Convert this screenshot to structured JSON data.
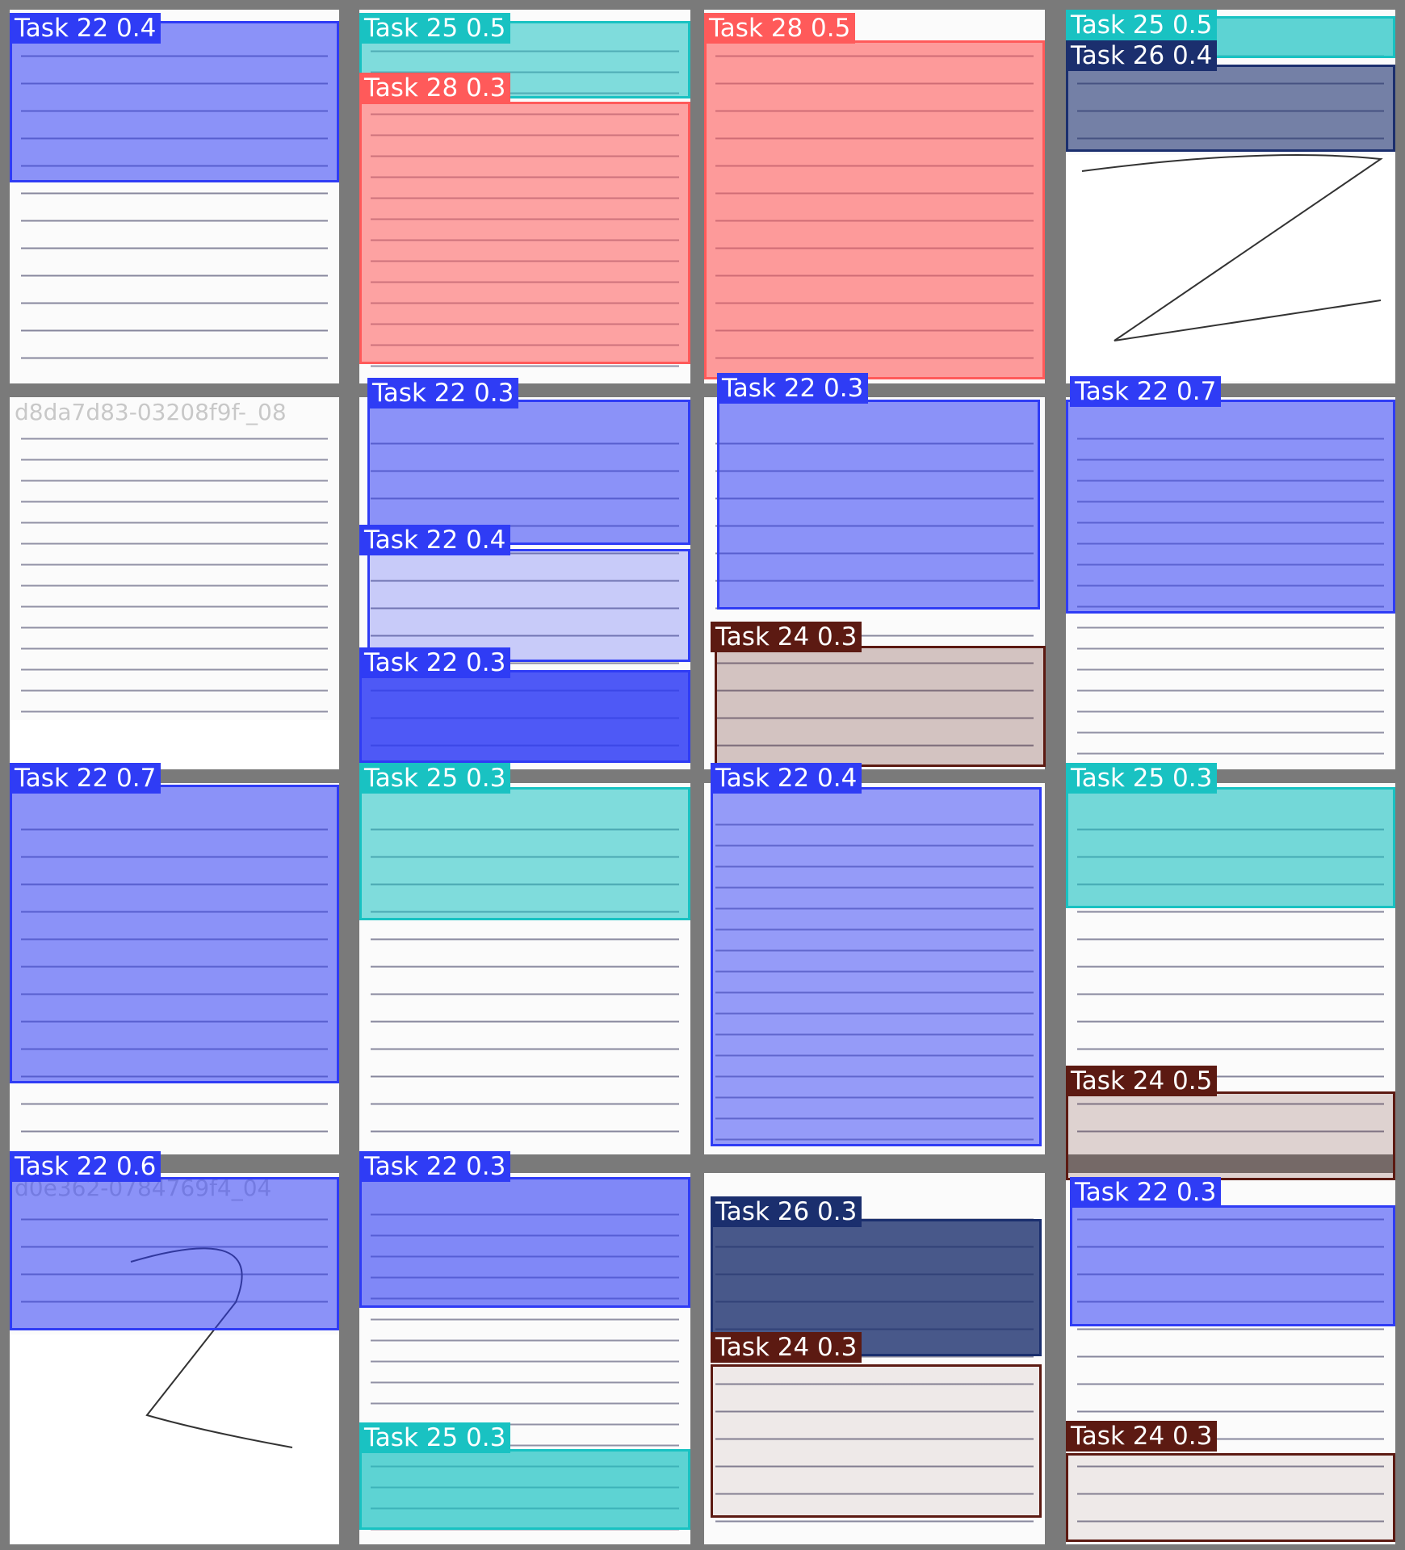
{
  "tiles": [
    {
      "id": "tile-1",
      "file": "0",
      "text_lines": 14
    },
    {
      "id": "tile-2",
      "file": "",
      "text_lines": 14
    },
    {
      "id": "tile-3",
      "file": "0",
      "text_lines": 14
    },
    {
      "id": "tile-4",
      "file": "",
      "text_lines": 6
    },
    {
      "id": "tile-5",
      "file": "d8da7d83-03208f9f-_08",
      "text_lines": 14
    },
    {
      "id": "tile-6",
      "file": "",
      "text_lines": 14
    },
    {
      "id": "tile-7",
      "file": "",
      "text_lines": 14
    },
    {
      "id": "tile-8",
      "file": "",
      "text_lines": 14
    },
    {
      "id": "tile-9",
      "file": "",
      "text_lines": 14
    },
    {
      "id": "tile-10",
      "file": "",
      "text_lines": 14
    },
    {
      "id": "tile-11",
      "file": "",
      "text_lines": 14
    },
    {
      "id": "tile-12",
      "file": "",
      "text_lines": 14
    },
    {
      "id": "tile-13",
      "file": "d0e362-0784769f4_04",
      "text_lines": 8
    },
    {
      "id": "tile-14",
      "file": "",
      "text_lines": 14
    },
    {
      "id": "tile-15",
      "file": "",
      "text_lines": 14
    },
    {
      "id": "tile-16",
      "file": "",
      "text_lines": 14
    }
  ],
  "colors": {
    "task_22": "#2f3cf5",
    "task_25": "#19c2c2",
    "task_26": "#1b2f6e",
    "task_28": "#ff5a5a",
    "task_24": "#5c1a12"
  },
  "detections": [
    {
      "label": "Task 22 0.4",
      "color": "task_22"
    },
    {
      "label": "Task 25 0.5",
      "color": "task_25"
    },
    {
      "label": "Task 28 0.3",
      "color": "task_28"
    },
    {
      "label": "Task 28 0.5",
      "color": "task_28"
    },
    {
      "label": "Task 25 0.5",
      "color": "task_25"
    },
    {
      "label": "Task 26 0.4",
      "color": "task_26"
    },
    {
      "label": "Task 22 0.3",
      "color": "task_22"
    },
    {
      "label": "Task 22 0.4",
      "color": "task_22"
    },
    {
      "label": "Task 22 0.3",
      "color": "task_22"
    },
    {
      "label": "Task 22 0.3",
      "color": "task_22"
    },
    {
      "label": "Task 24 0.3",
      "color": "task_24"
    },
    {
      "label": "Task 22 0.7",
      "color": "task_22"
    },
    {
      "label": "Task 22 0.7",
      "color": "task_22"
    },
    {
      "label": "Task 25 0.3",
      "color": "task_25"
    },
    {
      "label": "Task 22 0.4",
      "color": "task_22"
    },
    {
      "label": "Task 25 0.3",
      "color": "task_25"
    },
    {
      "label": "Task 24 0.5",
      "color": "task_24"
    },
    {
      "label": "Task 22 0.6",
      "color": "task_22"
    },
    {
      "label": "Task 22 0.3",
      "color": "task_22"
    },
    {
      "label": "Task 25 0.3",
      "color": "task_25"
    },
    {
      "label": "Task 26 0.3",
      "color": "task_26"
    },
    {
      "label": "Task 24 0.3",
      "color": "task_24"
    },
    {
      "label": "Task 22 0.3",
      "color": "task_22"
    },
    {
      "label": "Task 24 0.3",
      "color": "task_24"
    }
  ]
}
